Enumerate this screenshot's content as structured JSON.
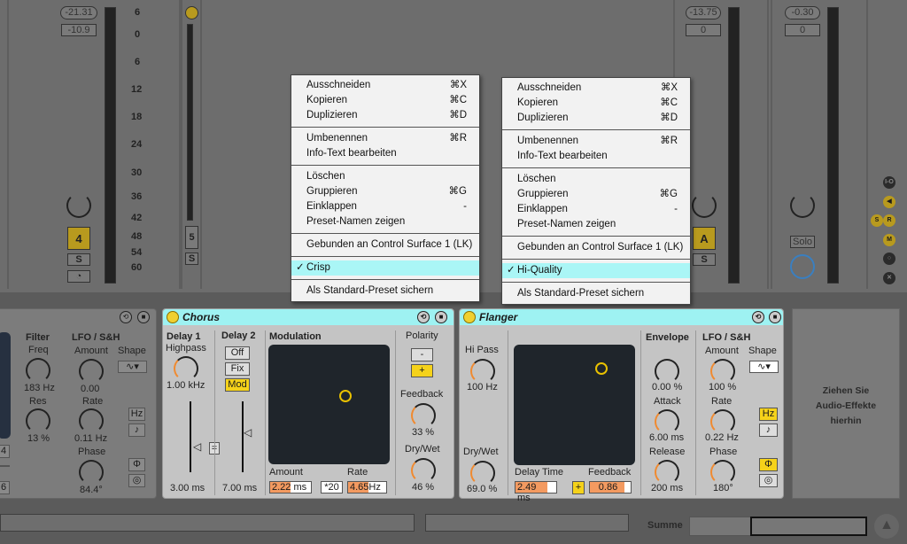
{
  "mixer": {
    "track4": {
      "peak": "-21.31",
      "volume": "-10.9",
      "number": "4",
      "solo": "S"
    },
    "track5": {
      "number": "5",
      "solo": "S"
    },
    "trackA": {
      "peak": "-13.75",
      "volume": "0",
      "number": "A",
      "solo": "S"
    },
    "master": {
      "peak": "-0.30",
      "volume": "0",
      "solo": "Solo"
    },
    "scale": [
      "6",
      "0",
      "6",
      "12",
      "18",
      "24",
      "30",
      "36",
      "42",
      "48",
      "54",
      "60"
    ],
    "side_buttons": [
      "I-O",
      "S",
      "R",
      "M"
    ]
  },
  "menu_left": {
    "items": [
      {
        "label": "Ausschneiden",
        "shortcut": "⌘X"
      },
      {
        "label": "Kopieren",
        "shortcut": "⌘C"
      },
      {
        "label": "Duplizieren",
        "shortcut": "⌘D"
      },
      {
        "label": "Umbenennen",
        "shortcut": "⌘R"
      },
      {
        "label": "Info-Text bearbeiten",
        "shortcut": ""
      },
      {
        "label": "Löschen",
        "shortcut": ""
      },
      {
        "label": "Gruppieren",
        "shortcut": "⌘G"
      },
      {
        "label": "Einklappen",
        "shortcut": "-"
      },
      {
        "label": "Preset-Namen zeigen",
        "shortcut": ""
      },
      {
        "label": "Gebunden an Control Surface 1 (LK)",
        "shortcut": ""
      },
      {
        "label": "Crisp",
        "shortcut": "",
        "checked": true
      },
      {
        "label": "Als Standard-Preset sichern",
        "shortcut": ""
      }
    ]
  },
  "menu_right": {
    "items": [
      {
        "label": "Ausschneiden",
        "shortcut": "⌘X"
      },
      {
        "label": "Kopieren",
        "shortcut": "⌘C"
      },
      {
        "label": "Duplizieren",
        "shortcut": "⌘D"
      },
      {
        "label": "Umbenennen",
        "shortcut": "⌘R"
      },
      {
        "label": "Info-Text bearbeiten",
        "shortcut": ""
      },
      {
        "label": "Löschen",
        "shortcut": ""
      },
      {
        "label": "Gruppieren",
        "shortcut": "⌘G"
      },
      {
        "label": "Einklappen",
        "shortcut": "-"
      },
      {
        "label": "Preset-Namen zeigen",
        "shortcut": ""
      },
      {
        "label": "Gebunden an Control Surface 1 (LK)",
        "shortcut": ""
      },
      {
        "label": "Hi-Quality",
        "shortcut": "",
        "checked": true
      },
      {
        "label": "Als Standard-Preset sichern",
        "shortcut": ""
      }
    ]
  },
  "check": "✓",
  "prev_device": {
    "filter": "Filter",
    "freq": "Freq",
    "freq_val": "183 Hz",
    "res": "Res",
    "res_val": "13 %",
    "lfo": "LFO / S&H",
    "amount": "Amount",
    "amount_val": "0.00",
    "shape": "Shape",
    "rate": "Rate",
    "rate_val": "0.11 Hz",
    "phase": "Phase",
    "phase_val": "84.4°",
    "hz": "Hz",
    "note": "♪",
    "phi": "Φ",
    "left_vals": [
      "4",
      "",
      "6"
    ]
  },
  "chorus": {
    "title": "Chorus",
    "delay1": "Delay 1",
    "highpass": "Highpass",
    "highpass_val": "1.00 kHz",
    "delay1_val": "3.00 ms",
    "delay2": "Delay 2",
    "off": "Off",
    "fix": "Fix",
    "mod": "Mod",
    "delay2_val": "7.00 ms",
    "link": "=",
    "modulation": "Modulation",
    "amount": "Amount",
    "amount_val": "2.22",
    "amount_unit": "ms",
    "mult": "*20",
    "rate": "Rate",
    "rate_val": "4.65",
    "rate_unit": "Hz",
    "polarity": "Polarity",
    "minus": "-",
    "plus": "+",
    "feedback": "Feedback",
    "feedback_val": "33 %",
    "drywet": "Dry/Wet",
    "drywet_val": "46 %"
  },
  "flanger": {
    "title": "Flanger",
    "hipass": "Hi Pass",
    "hipass_val": "100 Hz",
    "drywet": "Dry/Wet",
    "drywet_val": "69.0 %",
    "delay_time": "Delay Time",
    "delay_time_val": "2.49 ms",
    "plus": "+",
    "feedback": "Feedback",
    "feedback_val": "0.86",
    "envelope": "Envelope",
    "env_val": "0.00 %",
    "attack": "Attack",
    "attack_val": "6.00 ms",
    "release": "Release",
    "release_val": "200 ms",
    "lfo": "LFO / S&H",
    "amount": "Amount",
    "amount_val": "100 %",
    "shape": "Shape",
    "rate": "Rate",
    "rate_val": "0.22 Hz",
    "phase": "Phase",
    "phase_val": "180°",
    "hz": "Hz",
    "note": "♪",
    "phi": "Φ"
  },
  "drop_area": {
    "line1": "Ziehen Sie",
    "line2": "Audio-Effekte",
    "line3": "hierhin"
  },
  "footer": {
    "summe": "Summe"
  }
}
